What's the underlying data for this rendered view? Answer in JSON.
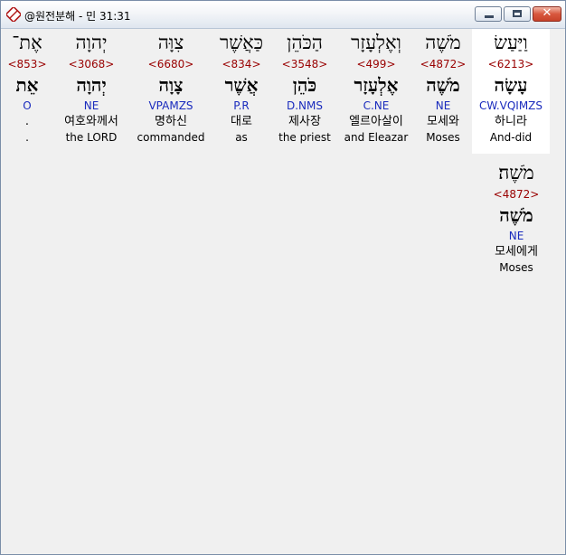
{
  "window": {
    "title": "@원전분해 - 민 31:31",
    "close_symbol": "✕"
  },
  "words": [
    {
      "hebrew": "וַיַּעַשׂ",
      "strong": "<6213>",
      "lemma": "עָשָׂה",
      "morph": "CW.VQIMZS",
      "korean": "하니라",
      "english": "And-did"
    },
    {
      "hebrew": "מֹשֶׁה",
      "strong": "<4872>",
      "lemma": "מֹשֶׁה",
      "morph": "NE",
      "korean": "모세와",
      "english": "Moses"
    },
    {
      "hebrew": "וְאֶלְעָזָר",
      "strong": "<499>",
      "lemma": "אֶלְעָזָר",
      "morph": "C.NE",
      "korean": "엘르아살이",
      "english": "and Eleazar"
    },
    {
      "hebrew": "הַכֹּהֵן",
      "strong": "<3548>",
      "lemma": "כֹּהֵן",
      "morph": "D.NMS",
      "korean": "제사장",
      "english": "the priest"
    },
    {
      "hebrew": "כַּאֲשֶׁר",
      "strong": "<834>",
      "lemma": "אֲשֶׁר",
      "morph": "P.R",
      "korean": "대로",
      "english": "as"
    },
    {
      "hebrew": "צִוָּה",
      "strong": "<6680>",
      "lemma": "צָוָה",
      "morph": "VPAMZS",
      "korean": "명하신",
      "english": "commanded"
    },
    {
      "hebrew": "יְהוָה",
      "strong": "<3068>",
      "lemma": "יְהוָה",
      "morph": "NE",
      "korean": "여호와께서",
      "english": "the LORD"
    },
    {
      "hebrew": "אֶת־",
      "strong": "<853>",
      "lemma": "אֵת",
      "morph": "O",
      "korean": ".",
      "english": "."
    },
    {
      "hebrew": "מֹשֶׁה׃",
      "strong": "<4872>",
      "lemma": "מֹשֶׁה",
      "morph": "NE",
      "korean": "모세에게",
      "english": "Moses"
    }
  ]
}
